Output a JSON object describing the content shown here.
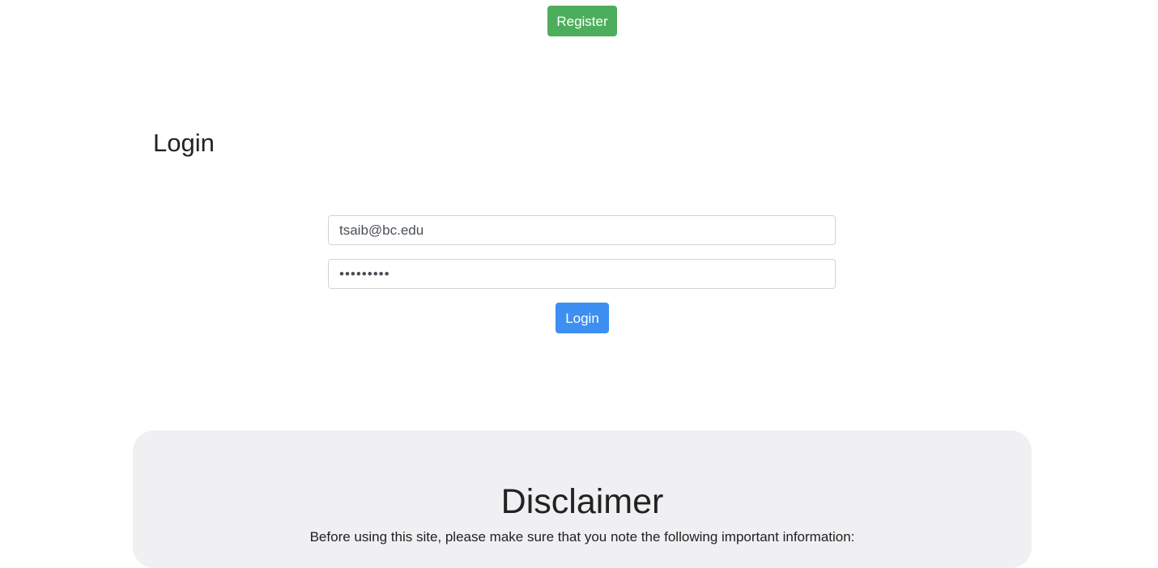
{
  "header": {
    "register_label": "Register"
  },
  "login": {
    "title": "Login",
    "email_value": "tsaib@bc.edu",
    "password_value": "•••••••••",
    "submit_label": "Login"
  },
  "disclaimer": {
    "title": "Disclaimer",
    "intro": "Before using this site, please make sure that you note the following important information:"
  },
  "colors": {
    "register_button": "#4cae5c",
    "login_button": "#3d8ff2",
    "disclaimer_background": "#f0f0f3"
  }
}
